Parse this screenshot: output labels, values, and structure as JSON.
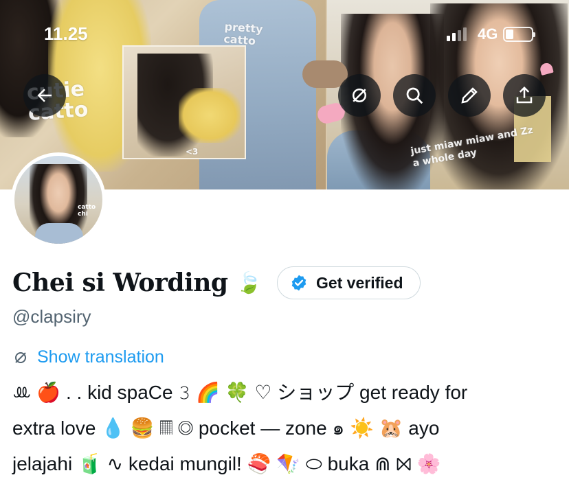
{
  "status_bar": {
    "time": "11.25",
    "network": "4G"
  },
  "banner": {
    "doodle_left": "cutie\ncatto",
    "doodle_inset": "pretty\ncatto",
    "doodle_right": "just miaw miaw and Zz\na whole day",
    "doodle_small": "<3"
  },
  "avatar": {
    "caption": "catto\nchi"
  },
  "nav": {
    "back_icon": "back-arrow-icon",
    "translate_icon": "translate-icon",
    "search_icon": "search-icon",
    "edit_icon": "edit-icon",
    "share_icon": "share-icon"
  },
  "profile": {
    "display_name": "Chei si Wording",
    "name_emoji": "🍃",
    "verify_label": "Get verified",
    "handle": "@clapsiry",
    "translate_label": "Show translation",
    "bio_lines": [
      "ꔛ 🍎 . . kid spaCe 𝟹 🌈 🍀 ♡ ショップ get ready for",
      "extra love 💧 🍔 𝄜 ◎ pocket — zone ๑ ☀️ 🐹 ayo",
      "jelajahi 🧃 ∿ kedai mungil! 🍣 🪁 ⬭ buka ⋒ ⨝ 🌸"
    ]
  },
  "colors": {
    "link_blue": "#1d9bf0",
    "handle_gray": "#536471",
    "text": "#0f1419",
    "nav_button_bg": "#0f1419"
  }
}
